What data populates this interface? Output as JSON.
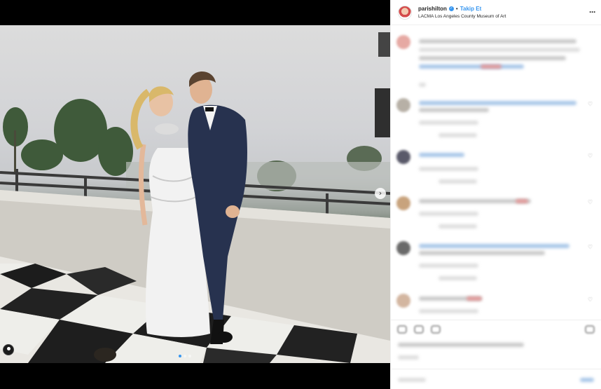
{
  "post": {
    "username": "parishilton",
    "follow_label": "Takip Et",
    "location": "LACMA Los Angeles County Museum of Art",
    "more_icon": "more-horizontal-icon",
    "next_icon": "chevron-right-icon",
    "carousel_count": 3,
    "carousel_active": 1
  },
  "colors": {
    "accent": "#3897f0",
    "text": "#262626",
    "border": "#efefef"
  }
}
